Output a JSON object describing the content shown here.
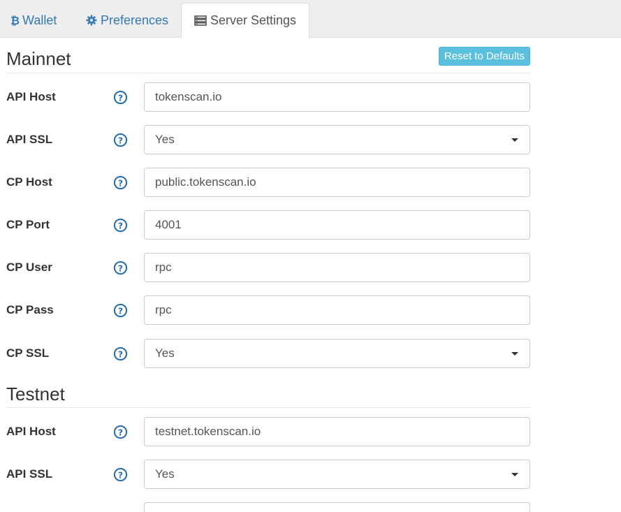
{
  "tabs": [
    {
      "label": "Wallet",
      "icon": "bitcoin-icon",
      "active": false
    },
    {
      "label": "Preferences",
      "icon": "gear-icon",
      "active": false
    },
    {
      "label": "Server Settings",
      "icon": "server-icon",
      "active": true
    }
  ],
  "mainnet": {
    "title": "Mainnet",
    "reset_label": "Reset to Defaults",
    "fields": {
      "api_host": {
        "label": "API Host",
        "value": "tokenscan.io"
      },
      "api_ssl": {
        "label": "API SSL",
        "value": "Yes"
      },
      "cp_host": {
        "label": "CP Host",
        "value": "public.tokenscan.io"
      },
      "cp_port": {
        "label": "CP Port",
        "value": "4001"
      },
      "cp_user": {
        "label": "CP User",
        "value": "rpc"
      },
      "cp_pass": {
        "label": "CP Pass",
        "value": "rpc"
      },
      "cp_ssl": {
        "label": "CP SSL",
        "value": "Yes"
      }
    }
  },
  "testnet": {
    "title": "Testnet",
    "fields": {
      "api_host": {
        "label": "API Host",
        "value": "testnet.tokenscan.io"
      },
      "api_ssl": {
        "label": "API SSL",
        "value": "Yes"
      }
    }
  },
  "colors": {
    "link": "#337ab7",
    "info_button": "#5bc0de",
    "help_icon": "#2a6fb0"
  }
}
